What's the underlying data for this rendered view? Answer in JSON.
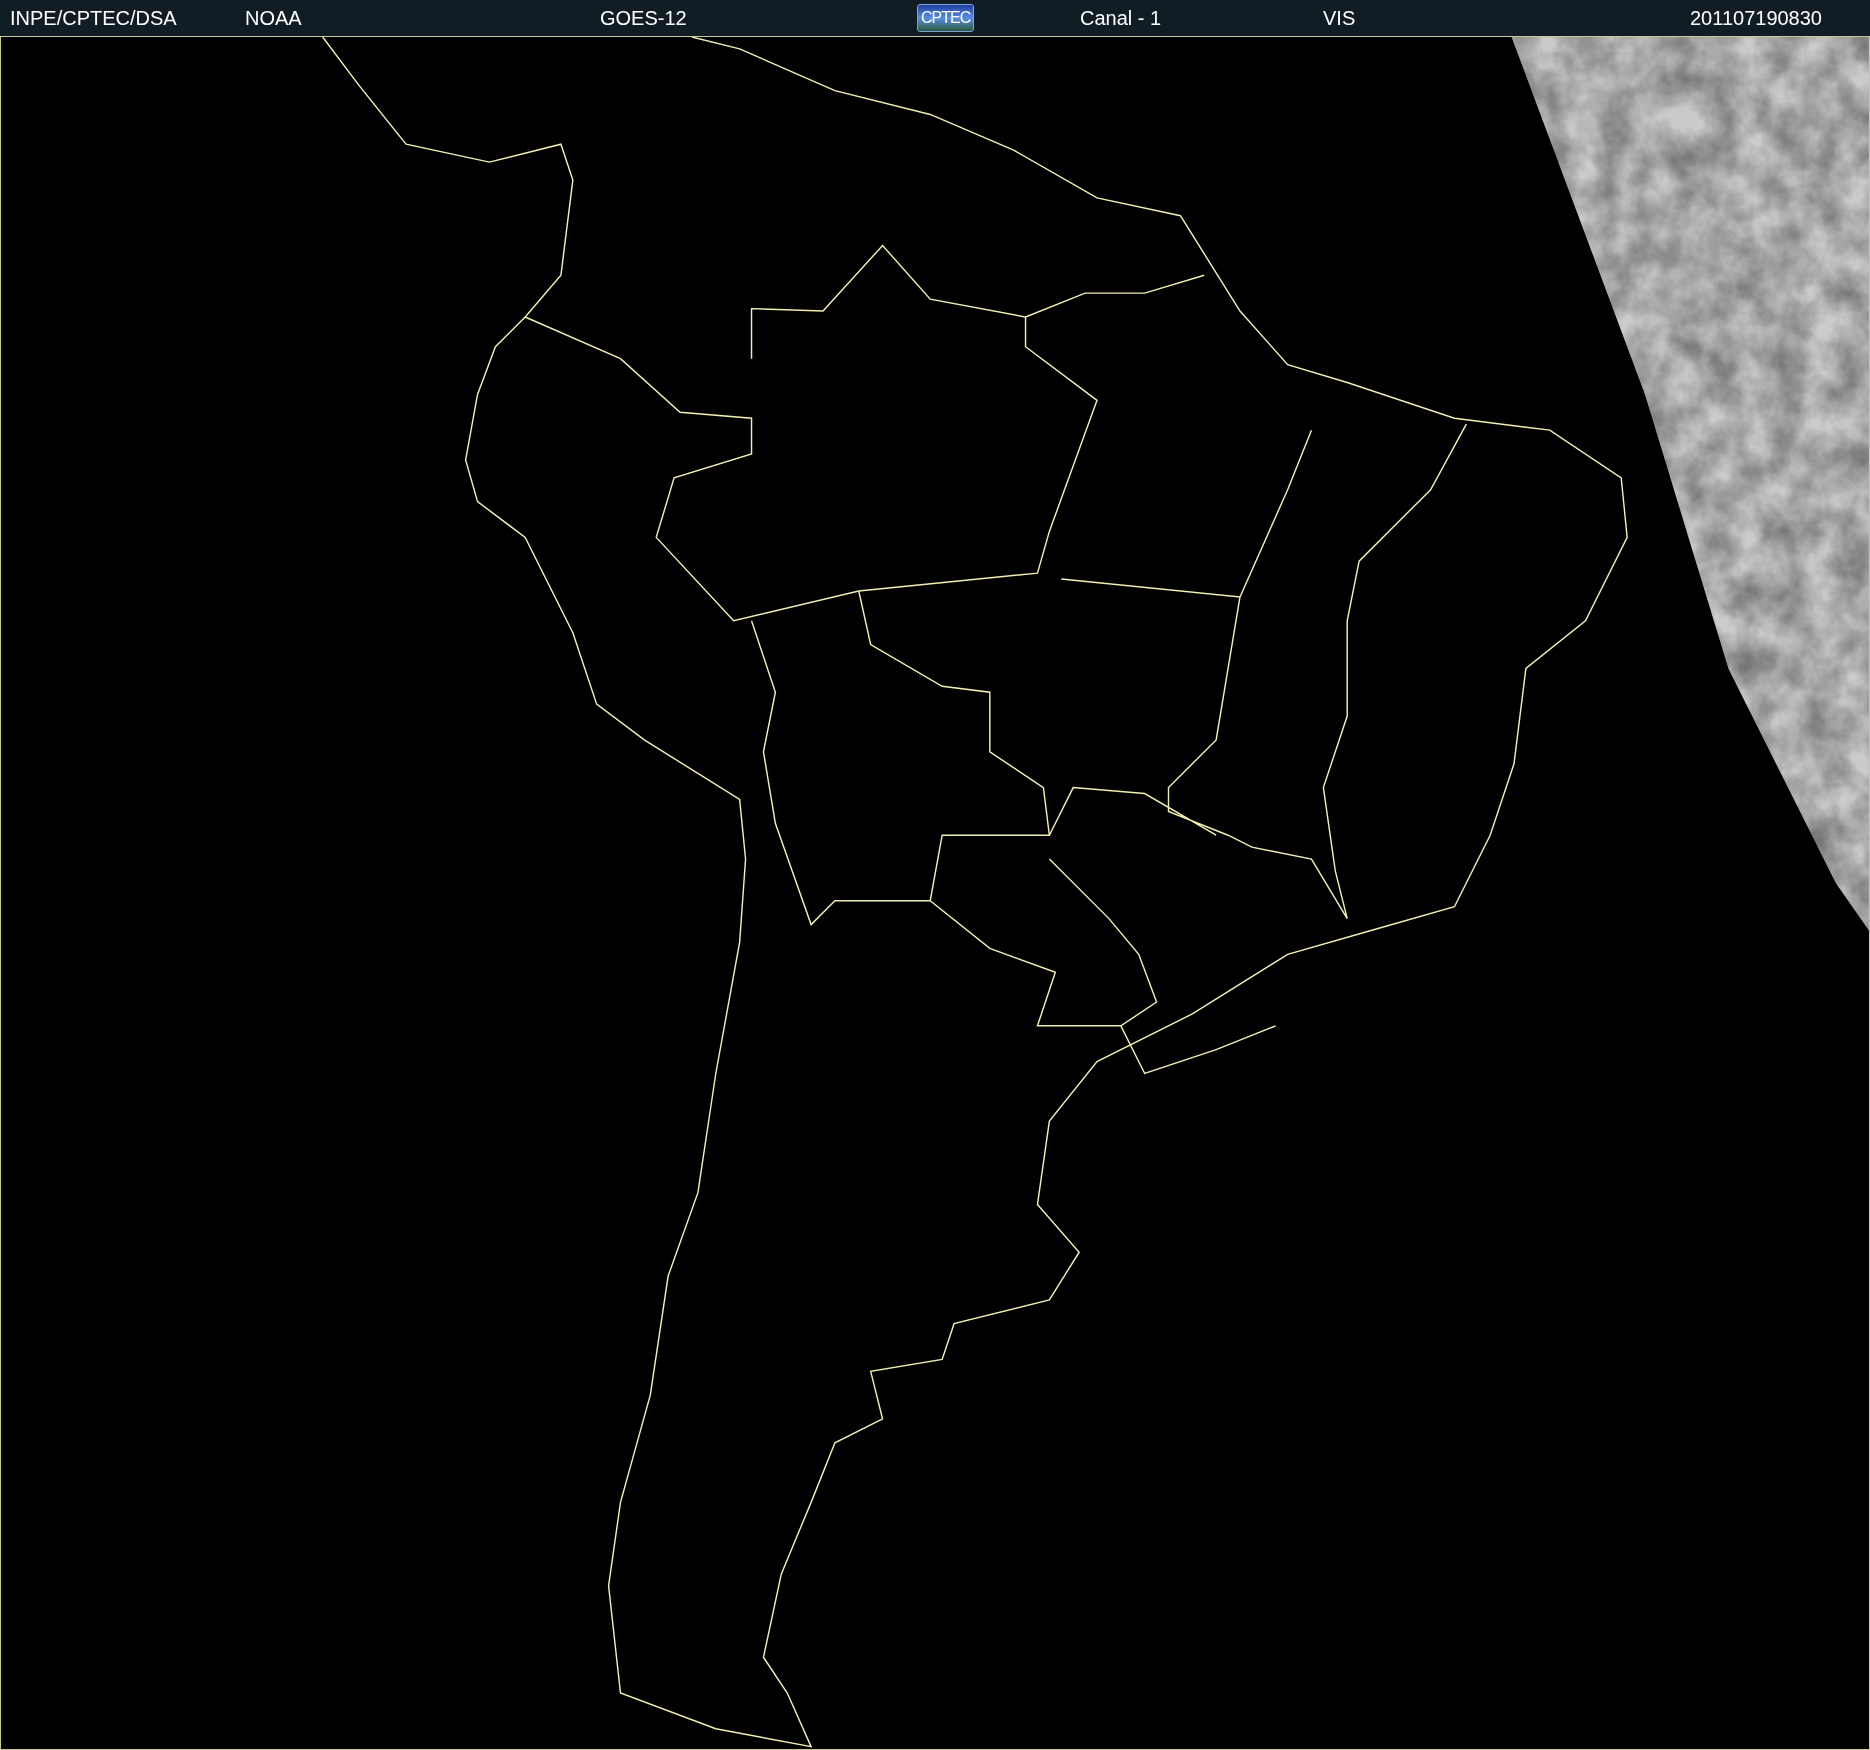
{
  "header": {
    "items": [
      {
        "kind": "text",
        "text": "INPE/CPTEC/DSA"
      },
      {
        "kind": "text",
        "text": "NOAA"
      },
      {
        "kind": "text",
        "text": "GOES-12"
      },
      {
        "kind": "logo",
        "text": "CPTEC"
      },
      {
        "kind": "text",
        "text": "Canal - 1"
      },
      {
        "kind": "text",
        "text": "VIS"
      },
      {
        "kind": "text",
        "text": "201107190830"
      }
    ]
  }
}
